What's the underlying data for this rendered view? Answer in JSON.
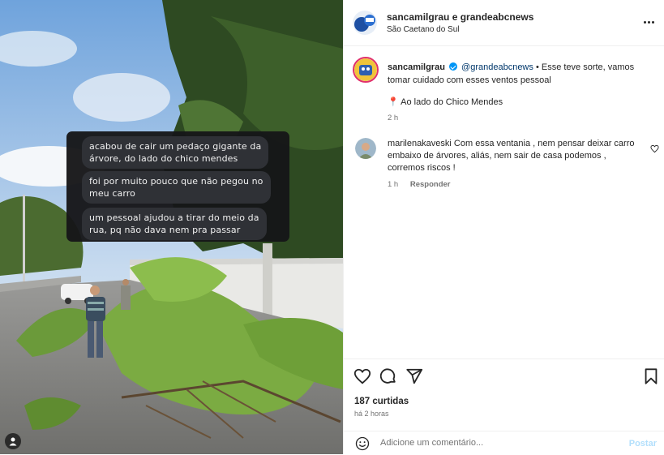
{
  "photo": {
    "messages": [
      [
        "acabou de cair um pedaço gigante da",
        "árvore, do lado do chico mendes"
      ],
      [
        "foi por muito pouco que não pegou no",
        "meu carro"
      ],
      [
        "um pessoal ajudou a tirar do meio da",
        "rua, pq não dava nem pra passar"
      ]
    ],
    "tag_icon": "user-tag-icon"
  },
  "header": {
    "title": "sancamilgrau e grandeabcnews",
    "location": "São Caetano do Sul",
    "more_icon": "more-options-icon"
  },
  "caption": {
    "username": "sancamilgrau",
    "mention": "@grandeabcnews",
    "text": " • Esse teve sorte, vamos tomar cuidado com esses ventos pessoal",
    "location_pin": "📍",
    "location_text": "Ao lado do Chico Mendes",
    "time": "2 h"
  },
  "comment": {
    "username": "marilenakaveski",
    "text": " Com essa ventania , nem pensar deixar carro embaixo de árvores, aliás, nem sair de casa podemos , corremos riscos !",
    "time": "1 h",
    "reply_label": "Responder"
  },
  "actions": {
    "likes": "187 curtidas",
    "ago": "há 2 horas"
  },
  "add_comment": {
    "placeholder": "Adicione um comentário...",
    "post_label": "Postar"
  },
  "colors": {
    "accent": "#0095f6",
    "mention": "#00376b",
    "post_disabled": "#b2dffc",
    "story_ring": "#e1306c"
  }
}
